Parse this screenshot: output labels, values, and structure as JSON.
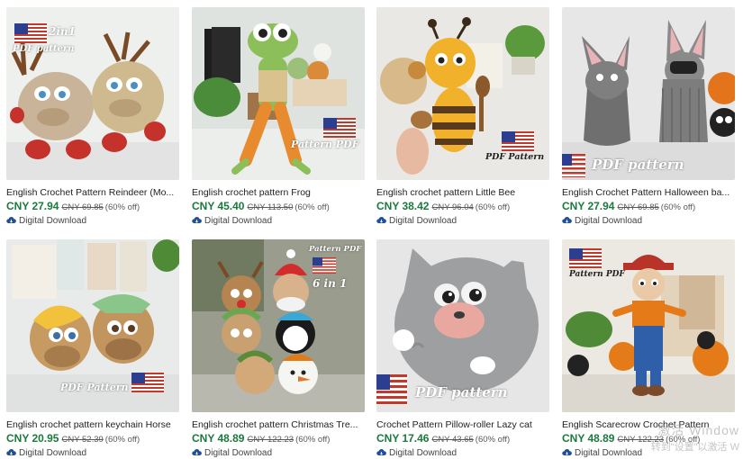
{
  "listings": [
    {
      "title": "English Crochet Pattern Reindeer (Mo...",
      "price": "CNY 27.94",
      "original_price": "CNY 69.85",
      "discount": "(60% off)",
      "delivery": "Digital Download",
      "badge_lines": [
        "2in1",
        "PDF pattern"
      ],
      "colors": {
        "bg": "#eef0ee",
        "toy": "#c9b49a",
        "accent": "#c5322b"
      }
    },
    {
      "title": "English crochet pattern Frog",
      "price": "CNY 45.40",
      "original_price": "CNY 113.50",
      "discount": "(60% off)",
      "delivery": "Digital Download",
      "badge_lines": [
        "Pattern PDF"
      ],
      "colors": {
        "bg": "#dfe3e0",
        "toy": "#8cbe5a",
        "accent": "#e88b2e"
      }
    },
    {
      "title": "English crochet pattern Little Bee",
      "price": "CNY 38.42",
      "original_price": "CNY 96.04",
      "discount": "(60% off)",
      "delivery": "Digital Download",
      "badge_lines": [
        "PDF Pattern"
      ],
      "colors": {
        "bg": "#e9e8e4",
        "toy": "#f2b12a",
        "accent": "#5a3a1c"
      }
    },
    {
      "title": "English Crochet Pattern Halloween ba...",
      "price": "CNY 27.94",
      "original_price": "CNY 69.85",
      "discount": "(60% off)",
      "delivery": "Digital Download",
      "badge_lines": [
        "PDF pattern"
      ],
      "colors": {
        "bg": "#e7e7e7",
        "toy": "#7f7f80",
        "accent": "#e3741c"
      }
    },
    {
      "title": "English crochet pattern keychain Horse",
      "price": "CNY 20.95",
      "original_price": "CNY 52.39",
      "discount": "(60% off)",
      "delivery": "Digital Download",
      "badge_lines": [
        "PDF Pattern"
      ],
      "colors": {
        "bg": "#e9eaea",
        "toy": "#c79a62",
        "accent": "#f2c23c"
      }
    },
    {
      "title": "English crochet pattern Christmas Tre...",
      "price": "CNY 48.89",
      "original_price": "CNY 122.23",
      "discount": "(60% off)",
      "delivery": "Digital Download",
      "badge_lines": [
        "Pattern PDF",
        "6 in 1"
      ],
      "colors": {
        "bg": "#9a9c8e",
        "toy": "#d8b28a",
        "accent": "#d22c2c"
      }
    },
    {
      "title": "Crochet Pattern Pillow-roller Lazy cat",
      "price": "CNY 17.46",
      "original_price": "CNY 43.65",
      "discount": "(60% off)",
      "delivery": "Digital Download",
      "badge_lines": [
        "PDF pattern"
      ],
      "colors": {
        "bg": "#e6e6e6",
        "toy": "#9d9fa1",
        "accent": "#e8a8a0"
      }
    },
    {
      "title": "English Scarecrow Crochet Pattern",
      "price": "CNY 48.89",
      "original_price": "CNY 122.23",
      "discount": "(60% off)",
      "delivery": "Digital Download",
      "badge_lines": [
        "Pattern PDF"
      ],
      "colors": {
        "bg": "#ece8e2",
        "toy": "#2f5fa8",
        "accent": "#e57a18"
      }
    }
  ],
  "watermark": {
    "line1": "激活 Window",
    "line2": "转到\"设置\"以激活 W"
  }
}
